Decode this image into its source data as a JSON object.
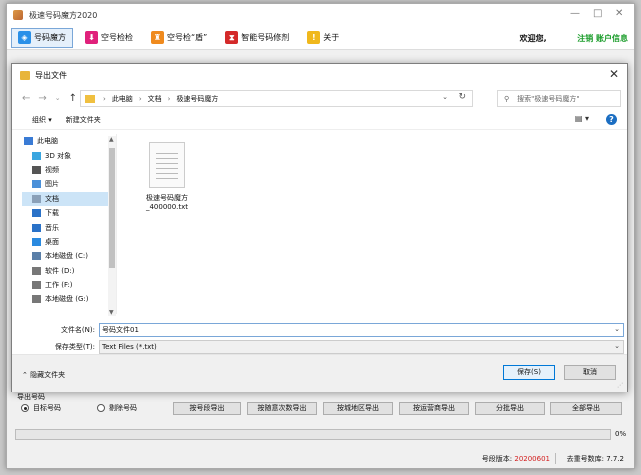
{
  "app": {
    "title": "极速号码魔方2020",
    "controls": {
      "minimize": "—",
      "maximize": "□",
      "close": "✕"
    }
  },
  "toolbar": {
    "items": [
      {
        "label": "号码魔方",
        "icon": "cube-icon",
        "color": "#2a90e8",
        "glyph": "◈"
      },
      {
        "label": "空号检检",
        "icon": "download-icon",
        "color": "#e0217b",
        "glyph": "⬇"
      },
      {
        "label": "空号检“盾”",
        "icon": "shield-icon",
        "color": "#ef8a1e",
        "glyph": "♜"
      },
      {
        "label": "智能号码修剂",
        "icon": "hourglass-icon",
        "color": "#d42a2a",
        "glyph": "⧗"
      },
      {
        "label": "关于",
        "icon": "warning-icon",
        "color": "#f0b81c",
        "glyph": "!"
      }
    ],
    "welcome": "欢迎您,",
    "account": "注销 账户信息"
  },
  "dialog": {
    "title": "导出文件",
    "address": {
      "crumbs": [
        "此电脑",
        "文档",
        "极速号码魔方"
      ]
    },
    "search_placeholder": "搜索\"极速号码魔方\"",
    "commands": {
      "organize": "组织 ▾",
      "new_folder": "新建文件夹",
      "view": "▤ ▾"
    },
    "nav_items": [
      {
        "label": "此电脑",
        "icon": "computer-icon",
        "color": "#3a7bd5",
        "indent": 0
      },
      {
        "label": "3D 对象",
        "icon": "3d-objects-icon",
        "color": "#3aa6e0",
        "indent": 1
      },
      {
        "label": "视频",
        "icon": "video-icon",
        "color": "#555555",
        "indent": 1
      },
      {
        "label": "图片",
        "icon": "pictures-icon",
        "color": "#4a90d9",
        "indent": 1
      },
      {
        "label": "文档",
        "icon": "documents-icon",
        "color": "#8aa0b8",
        "indent": 1,
        "selected": true
      },
      {
        "label": "下载",
        "icon": "downloads-icon",
        "color": "#2a72c8",
        "indent": 1
      },
      {
        "label": "音乐",
        "icon": "music-icon",
        "color": "#2a72c8",
        "indent": 1
      },
      {
        "label": "桌面",
        "icon": "desktop-icon",
        "color": "#2a8ae0",
        "indent": 1
      },
      {
        "label": "本地磁盘 (C:)",
        "icon": "drive-c-icon",
        "color": "#5a7fa8",
        "indent": 1
      },
      {
        "label": "软件 (D:)",
        "icon": "drive-d-icon",
        "color": "#777777",
        "indent": 1
      },
      {
        "label": "工作 (F:)",
        "icon": "drive-f-icon",
        "color": "#777777",
        "indent": 1
      },
      {
        "label": "本地磁盘 (G:)",
        "icon": "drive-g-icon",
        "color": "#777777",
        "indent": 1
      }
    ],
    "file": {
      "name_line1": "极速号码魔方",
      "name_line2": "_400000.txt"
    },
    "filename_label": "文件名(N):",
    "filename_value": "号码文件01",
    "filetype_label": "保存类型(T):",
    "filetype_value": "Text Files (*.txt)",
    "hide_folders": "隐藏文件夹",
    "save_button": "保存(S)",
    "cancel_button": "取消"
  },
  "export": {
    "group_label": "导出号码",
    "radio_target": "目标号码",
    "radio_filter": "剔除号码",
    "buttons": [
      "按号段导出",
      "按随意次数导出",
      "按城地区导出",
      "按运营商导出",
      "分批导出",
      "全部导出"
    ]
  },
  "progress": {
    "label": "0%",
    "value": 0
  },
  "status": {
    "version_label": "号段版本:",
    "version_value": "20200601",
    "user_label": "去重号数库:",
    "user_value": "7.7.2"
  }
}
